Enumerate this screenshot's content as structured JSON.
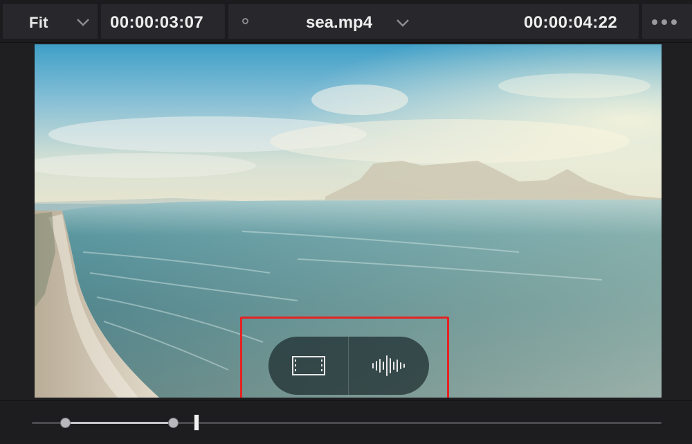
{
  "toolbar": {
    "zoom_label": "Fit",
    "source_timecode": "00:00:03:07",
    "clip_name": "sea.mp4",
    "record_timecode": "00:00:04:22"
  },
  "viewer": {
    "overlay_buttons": [
      {
        "name": "video-only-drag",
        "icon": "film-strip-icon"
      },
      {
        "name": "audio-only-drag",
        "icon": "waveform-icon"
      }
    ],
    "highlight_color": "#e52222"
  },
  "scrubber": {
    "in_point_fraction": 0.053,
    "out_point_fraction": 0.224,
    "playhead_fraction": 0.262
  },
  "colors": {
    "accent_highlight": "#e52222",
    "panel_bg": "#28282c",
    "app_bg": "#1f1f22"
  }
}
